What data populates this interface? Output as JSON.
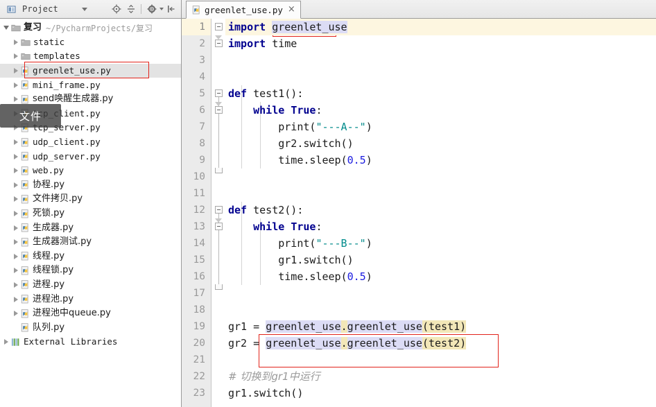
{
  "sidebar": {
    "panel_title": "Project",
    "project_icon": "project-panel-icon",
    "toolbar": [
      {
        "name": "locate-icon",
        "label": "Scroll from Source"
      },
      {
        "name": "collapse-all-icon",
        "label": "Collapse All"
      },
      {
        "name": "gear-icon",
        "label": "Settings"
      },
      {
        "name": "hide-panel-icon",
        "label": "Hide"
      }
    ],
    "tree": [
      {
        "name": "复习",
        "path": "~/PycharmProjects/复习",
        "icon": "folder-icon",
        "indent": 0,
        "twist": "open",
        "bold": true,
        "cjk": true
      },
      {
        "name": "static",
        "path": "",
        "icon": "folder-icon",
        "indent": 1,
        "twist": "closed",
        "bold": false,
        "cjk": false
      },
      {
        "name": "templates",
        "path": "",
        "icon": "folder-icon",
        "indent": 1,
        "twist": "closed",
        "bold": false,
        "cjk": false
      },
      {
        "name": "greenlet_use.py",
        "path": "",
        "icon": "python-file-icon",
        "indent": 1,
        "twist": "closed",
        "bold": false,
        "cjk": false,
        "selected": true
      },
      {
        "name": "mini_frame.py",
        "path": "",
        "icon": "python-file-icon",
        "indent": 1,
        "twist": "closed",
        "bold": false,
        "cjk": false
      },
      {
        "name": "send唤醒生成器.py",
        "path": "",
        "icon": "python-file-icon",
        "indent": 1,
        "twist": "closed",
        "bold": false,
        "cjk": true
      },
      {
        "name": "tcp_client.py",
        "path": "",
        "icon": "python-file-icon",
        "indent": 1,
        "twist": "closed",
        "bold": false,
        "cjk": false
      },
      {
        "name": "tcp_server.py",
        "path": "",
        "icon": "python-file-icon",
        "indent": 1,
        "twist": "closed",
        "bold": false,
        "cjk": false
      },
      {
        "name": "udp_client.py",
        "path": "",
        "icon": "python-file-icon",
        "indent": 1,
        "twist": "closed",
        "bold": false,
        "cjk": false
      },
      {
        "name": "udp_server.py",
        "path": "",
        "icon": "python-file-icon",
        "indent": 1,
        "twist": "closed",
        "bold": false,
        "cjk": false
      },
      {
        "name": "web.py",
        "path": "",
        "icon": "python-file-icon",
        "indent": 1,
        "twist": "closed",
        "bold": false,
        "cjk": false
      },
      {
        "name": "协程.py",
        "path": "",
        "icon": "python-file-icon",
        "indent": 1,
        "twist": "closed",
        "bold": false,
        "cjk": true
      },
      {
        "name": "文件拷贝.py",
        "path": "",
        "icon": "python-file-icon",
        "indent": 1,
        "twist": "closed",
        "bold": false,
        "cjk": true
      },
      {
        "name": "死锁.py",
        "path": "",
        "icon": "python-file-icon",
        "indent": 1,
        "twist": "closed",
        "bold": false,
        "cjk": true
      },
      {
        "name": "生成器.py",
        "path": "",
        "icon": "python-file-icon",
        "indent": 1,
        "twist": "closed",
        "bold": false,
        "cjk": true
      },
      {
        "name": "生成器测试.py",
        "path": "",
        "icon": "python-file-icon",
        "indent": 1,
        "twist": "closed",
        "bold": false,
        "cjk": true
      },
      {
        "name": "线程.py",
        "path": "",
        "icon": "python-file-icon",
        "indent": 1,
        "twist": "closed",
        "bold": false,
        "cjk": true
      },
      {
        "name": "线程锁.py",
        "path": "",
        "icon": "python-file-icon",
        "indent": 1,
        "twist": "closed",
        "bold": false,
        "cjk": true
      },
      {
        "name": "进程.py",
        "path": "",
        "icon": "python-file-icon",
        "indent": 1,
        "twist": "closed",
        "bold": false,
        "cjk": true
      },
      {
        "name": "进程池.py",
        "path": "",
        "icon": "python-file-icon",
        "indent": 1,
        "twist": "closed",
        "bold": false,
        "cjk": true
      },
      {
        "name": "进程池中queue.py",
        "path": "",
        "icon": "python-file-icon",
        "indent": 1,
        "twist": "closed",
        "bold": false,
        "cjk": true
      },
      {
        "name": "队列.py",
        "path": "",
        "icon": "python-file-icon",
        "indent": 1,
        "twist": "none",
        "bold": false,
        "cjk": true
      },
      {
        "name": "External Libraries",
        "path": "",
        "icon": "external-libraries-icon",
        "indent": 0,
        "twist": "closed",
        "bold": false,
        "cjk": false
      }
    ],
    "tooltip": "文件"
  },
  "editor": {
    "tab": {
      "label": "greenlet_use.py",
      "icon": "python-file-icon",
      "close": "×"
    },
    "lines": [
      {
        "n": "1",
        "text": "import greenlet_use"
      },
      {
        "n": "2",
        "text": "import time"
      },
      {
        "n": "3",
        "text": ""
      },
      {
        "n": "4",
        "text": ""
      },
      {
        "n": "5",
        "text": "def test1():"
      },
      {
        "n": "6",
        "text": "    while True:"
      },
      {
        "n": "7",
        "text": "        print(\"---A--\")"
      },
      {
        "n": "8",
        "text": "        gr2.switch()"
      },
      {
        "n": "9",
        "text": "        time.sleep(0.5)"
      },
      {
        "n": "10",
        "text": ""
      },
      {
        "n": "11",
        "text": ""
      },
      {
        "n": "12",
        "text": "def test2():"
      },
      {
        "n": "13",
        "text": "    while True:"
      },
      {
        "n": "14",
        "text": "        print(\"---B--\")"
      },
      {
        "n": "15",
        "text": "        gr1.switch()"
      },
      {
        "n": "16",
        "text": "        time.sleep(0.5)"
      },
      {
        "n": "17",
        "text": ""
      },
      {
        "n": "18",
        "text": ""
      },
      {
        "n": "19",
        "text": "gr1 = greenlet_use.greenlet_use(test1)"
      },
      {
        "n": "20",
        "text": "gr2 = greenlet_use.greenlet_use(test2)"
      },
      {
        "n": "21",
        "text": ""
      },
      {
        "n": "22",
        "text": "# 切换到gr1中运行"
      },
      {
        "n": "23",
        "text": "gr1.switch()"
      }
    ],
    "tokens": {
      "kw_import": "import",
      "kw_def": "def",
      "kw_while": "while",
      "kw_true": "True",
      "mod_greenlet": "greenlet_use",
      "mod_time": "time",
      "fn_test1": "test1",
      "fn_test2": "test2",
      "str_a": "\"---A--\"",
      "str_b": "\"---B--\"",
      "num_half": "0.5",
      "call_print": "print",
      "call_sleep": "time.sleep",
      "gr1_switch": "gr1.switch()",
      "gr2_switch": "gr2.switch()",
      "var_gr1": "gr1",
      "var_gr2": "gr2",
      "assign": " = ",
      "comment": "# 切换到gr1中运行",
      "ctor": "greenlet_use.greenlet_use",
      "arg1": "(test1)",
      "arg2": "(test2)",
      "dot": "."
    },
    "current_line": 1
  },
  "colors": {
    "keyword": "#00008f",
    "string": "#008b8b",
    "number": "#1a1ae0",
    "comment": "#9a9a9a",
    "annotation_box": "#e2231a",
    "current_line_bg": "#fdf6e0",
    "selection_bg": "#dcdcf5",
    "occurrence_bg": "#f2e7b8",
    "gutter_bg": "#ebebeb",
    "tree_selected_bg": "#e3e3e3"
  }
}
